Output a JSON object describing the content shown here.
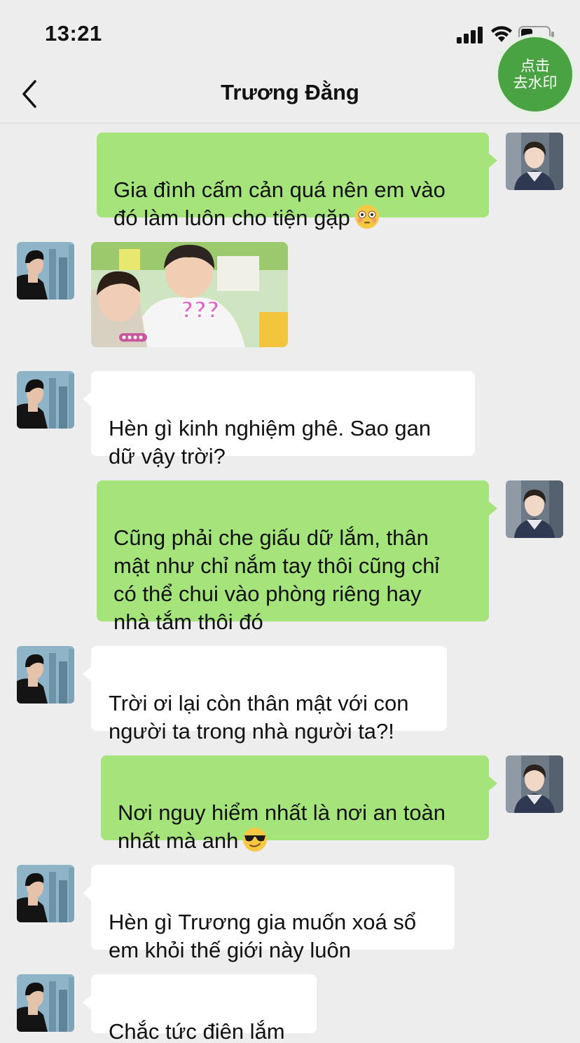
{
  "status_bar": {
    "time": "13:21"
  },
  "nav": {
    "title": "Trương Đằng"
  },
  "watermark_button": {
    "line1": "点击",
    "line2": "去水印"
  },
  "sticker": {
    "caption": "???"
  },
  "colors": {
    "incoming_bubble": "#ffffff",
    "outgoing_bubble": "#a5e47a",
    "background": "#ededed",
    "watermark_green": "#4aa343"
  },
  "messages": [
    {
      "side": "out",
      "text": "Gia đình cấm cản quá nên em vào\nđó làm luôn cho tiện gặp",
      "emoji": "flushed-face-emoji"
    },
    {
      "side": "in",
      "type": "sticker"
    },
    {
      "side": "in",
      "text": "Hèn gì kinh nghiệm ghê. Sao gan\ndữ vậy trời?"
    },
    {
      "side": "out",
      "text": "Cũng phải che giấu dữ lắm, thân\nmật như chỉ nắm tay thôi cũng chỉ\ncó thể chui vào phòng riêng hay\nnhà tắm thôi đó"
    },
    {
      "side": "in",
      "text": "Trời ơi lại còn thân mật với con\nngười ta trong nhà người ta?!"
    },
    {
      "side": "out",
      "text": "Nơi nguy hiểm nhất là nơi an toàn\nnhất mà anh",
      "emoji": "sunglasses-face-emoji"
    },
    {
      "side": "in",
      "text": "Hèn gì Trương gia muốn xoá sổ\nem khỏi thế giới này luôn"
    },
    {
      "side": "in",
      "text": "Chắc tức điên lắm"
    }
  ]
}
